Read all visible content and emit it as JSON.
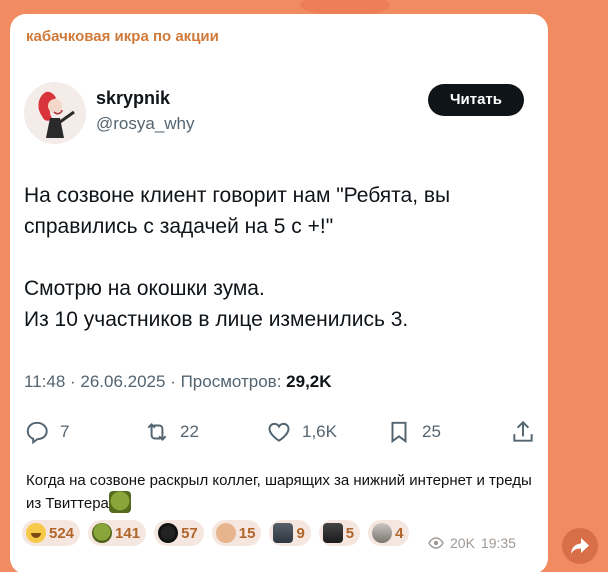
{
  "channel": {
    "name": "кабачковая икра по акции"
  },
  "tweet": {
    "author_name": "skrypnik",
    "author_handle": "@rosya_why",
    "follow_label": "Читать",
    "paragraphs": [
      "На созвоне клиент говорит нам \"Ребята, вы справились с задачей на 5 с +!\"",
      "Смотрю на окошки зума.\nИз 10 участников в лице изменились 3."
    ],
    "time_date": "11:48 · 26.06.2025 · Просмотров: ",
    "views": "29,2K",
    "replies": "7",
    "retweets": "22",
    "likes": "1,6K",
    "bookmarks": "25"
  },
  "caption": "Когда на созвоне раскрыл коллег, шарящих за нижний интернет и треды из Твиттера",
  "reactions": [
    {
      "icon": "laugh-emoji-icon",
      "count": "524"
    },
    {
      "icon": "shrek-sticker-icon",
      "count": "141"
    },
    {
      "icon": "sunglasses-cat-icon",
      "count": "57"
    },
    {
      "icon": "hands-sticker-icon",
      "count": "15"
    },
    {
      "icon": "photo-reaction-icon",
      "count": "9"
    },
    {
      "icon": "photo-reaction-icon",
      "count": "5"
    },
    {
      "icon": "photo-reaction-icon",
      "count": "4"
    }
  ],
  "message": {
    "views": "20K",
    "time": "19:35"
  },
  "colors": {
    "background": "#f08b62",
    "channel_name": "#d07a3a",
    "reaction_text": "#b0652b",
    "follow_button": "#0f1419"
  }
}
